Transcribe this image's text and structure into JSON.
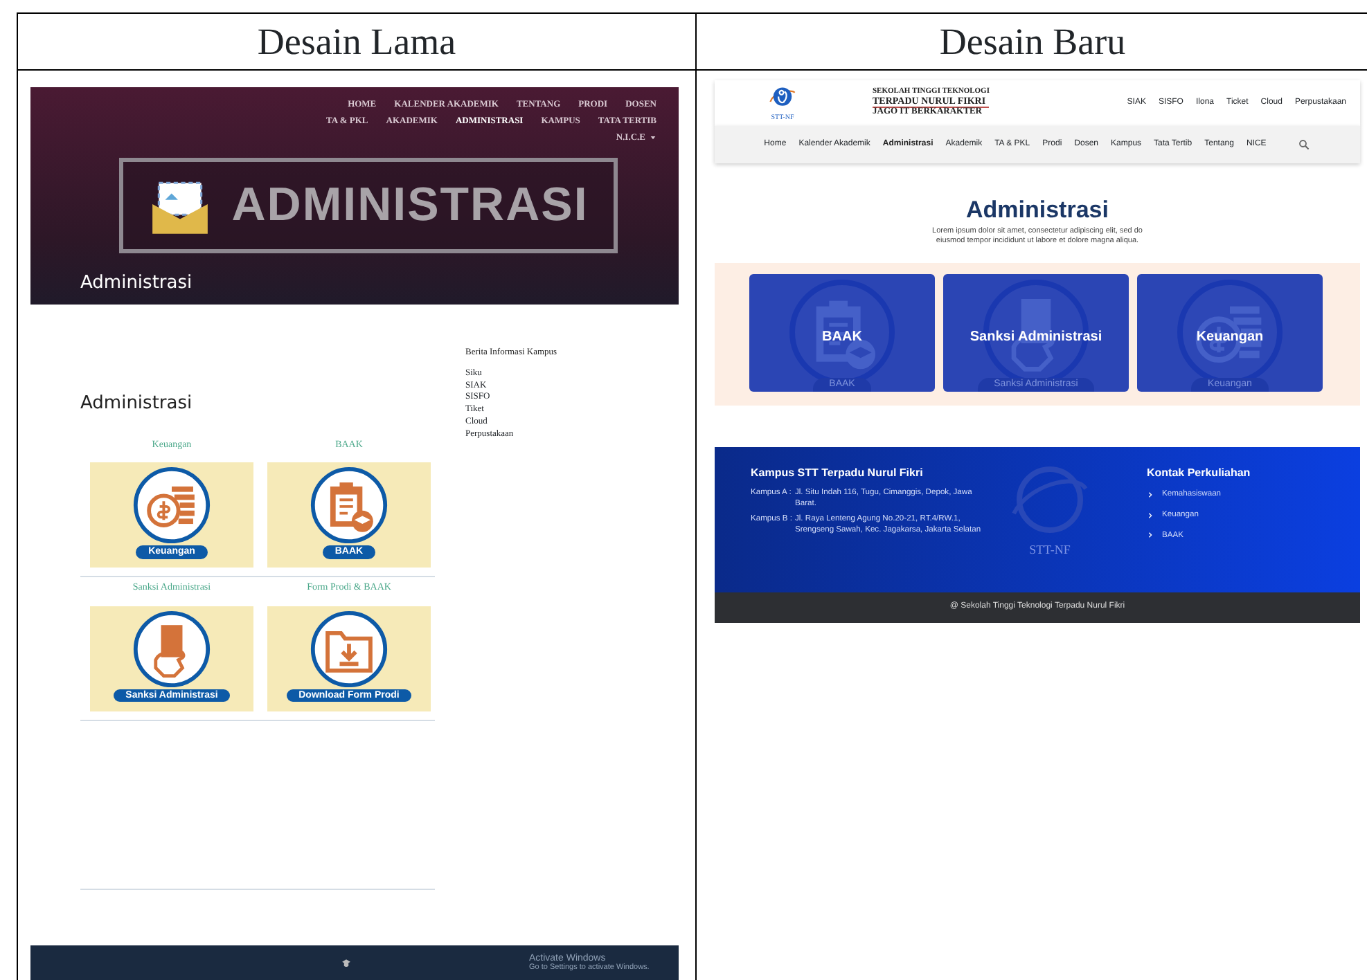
{
  "table": {
    "columns": [
      "Desain Lama",
      "Desain Baru"
    ]
  },
  "old_design": {
    "nav": [
      {
        "label": "HOME",
        "selected": false,
        "dropdown": false
      },
      {
        "label": "KALENDER AKADEMIK",
        "selected": false,
        "dropdown": false
      },
      {
        "label": "TENTANG",
        "selected": false,
        "dropdown": false
      },
      {
        "label": "PRODI",
        "selected": false,
        "dropdown": false
      },
      {
        "label": "DOSEN",
        "selected": false,
        "dropdown": false
      },
      {
        "label": "TA & PKL",
        "selected": false,
        "dropdown": false
      },
      {
        "label": "AKADEMIK",
        "selected": false,
        "dropdown": false
      },
      {
        "label": "ADMINISTRASI",
        "selected": true,
        "dropdown": false
      },
      {
        "label": "KAMPUS",
        "selected": false,
        "dropdown": false
      },
      {
        "label": "TATA TERTIB",
        "selected": false,
        "dropdown": false
      },
      {
        "label": "N.I.C.E",
        "selected": false,
        "dropdown": true
      }
    ],
    "banner_text": "ADMINISTRASI",
    "hero_title": "Administrasi",
    "page_title": "Administrasi",
    "cards": [
      {
        "caption": "Keuangan",
        "label": "Keuangan",
        "kind": "coins"
      },
      {
        "caption": "BAAK",
        "label": "BAAK",
        "kind": "clipboard"
      },
      {
        "caption": "Sanksi Administrasi",
        "label": "Sanksi Administrasi",
        "kind": "hand-card"
      },
      {
        "caption": "Form Prodi & BAAK",
        "label": "Download Form Prodi",
        "kind": "folder"
      }
    ],
    "sidebar": {
      "title": "Berita Informasi Kampus",
      "links": [
        "Siku",
        "SIAK",
        "SISFO",
        "Tiket",
        "Cloud",
        "Perpustakaan"
      ]
    },
    "windows_notice": {
      "title": "Activate Windows",
      "text": "Go to Settings to activate Windows."
    }
  },
  "new_design": {
    "header": {
      "lines": [
        "SEKOLAH TINGGI TEKNOLOGI",
        "TERPADU NURUL FIKRI",
        "JAGO IT BERKARAKTER"
      ],
      "logo_text": "STT-NF",
      "links": [
        "SIAK",
        "SISFO",
        "Ilona",
        "Ticket",
        "Cloud",
        "Perpustakaan"
      ]
    },
    "nav": [
      {
        "label": "Home",
        "selected": false
      },
      {
        "label": "Kalender Akademik",
        "selected": false
      },
      {
        "label": "Administrasi",
        "selected": true
      },
      {
        "label": "Akademik",
        "selected": false
      },
      {
        "label": "TA & PKL",
        "selected": false
      },
      {
        "label": "Prodi",
        "selected": false
      },
      {
        "label": "Dosen",
        "selected": false
      },
      {
        "label": "Kampus",
        "selected": false
      },
      {
        "label": "Tata Tertib",
        "selected": false
      },
      {
        "label": "Tentang",
        "selected": false
      },
      {
        "label": "NICE",
        "selected": false
      }
    ],
    "title": "Administrasi",
    "intro": "Lorem ipsum dolor sit amet, consectetur adipiscing elit, sed do eiusmod tempor incididunt ut labore et dolore magna aliqua.",
    "cards": [
      {
        "title": "BAAK",
        "label": "BAAK",
        "kind": "clipboard"
      },
      {
        "title": "Sanksi Administrasi",
        "label": "Sanksi Administrasi",
        "kind": "hand-card"
      },
      {
        "title": "Keuangan",
        "label": "Keuangan",
        "kind": "coins"
      }
    ],
    "footer": {
      "title": "Kampus STT Terpadu Nurul Fikri",
      "addresses": [
        {
          "name": "Kampus A :",
          "text": "Jl. Situ Indah 116, Tugu, Cimanggis, Depok, Jawa Barat."
        },
        {
          "name": "Kampus B :",
          "text": "Jl. Raya Lenteng Agung No.20-21, RT.4/RW.1, Srengseng Sawah, Kec. Jagakarsa, Jakarta Selatan"
        }
      ],
      "logo_text": "STT-NF",
      "contact_title": "Kontak Perkuliahan",
      "contacts": [
        "Kemahasiswaan",
        "Keuangan",
        "BAAK"
      ],
      "copyright": "@ Sekolah Tinggi Teknologi Terpadu Nurul Fikri"
    }
  }
}
